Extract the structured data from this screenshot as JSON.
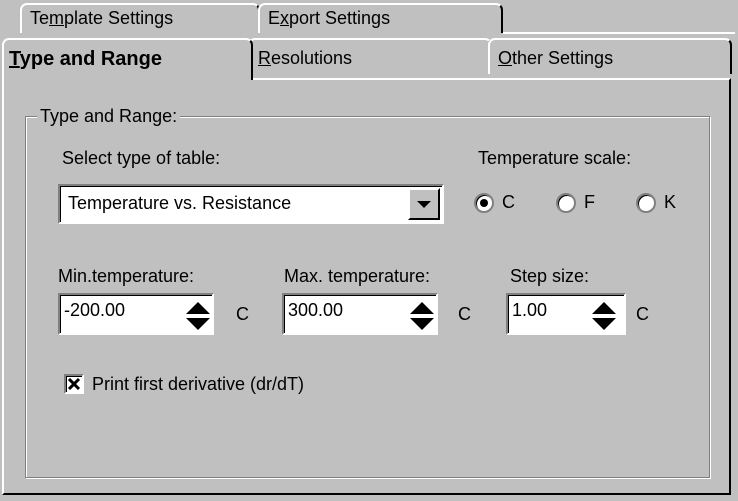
{
  "tabs": {
    "template": {
      "pre": "Te",
      "key": "m",
      "post": "plate Settings"
    },
    "export": {
      "pre": "E",
      "key": "x",
      "post": "port Settings"
    },
    "type_range": {
      "pre": "",
      "key": "T",
      "post": "ype and Range"
    },
    "resolutions": {
      "pre": "",
      "key": "R",
      "post": "esolutions"
    },
    "other": {
      "pre": "",
      "key": "O",
      "post": "ther Settings"
    }
  },
  "group": {
    "title": "Type and Range:"
  },
  "table_type": {
    "label": "Select type of table:",
    "value": "Temperature vs. Resistance"
  },
  "scale": {
    "label": "Temperature scale:",
    "options": [
      "C",
      "F",
      "K"
    ],
    "selected": "C"
  },
  "min_temp": {
    "label": "Min.temperature:",
    "value": "-200.00",
    "unit": "C"
  },
  "max_temp": {
    "label": "Max. temperature:",
    "value": "300.00",
    "unit": "C"
  },
  "step": {
    "label": "Step size:",
    "value": "1.00",
    "unit": "C"
  },
  "derivative": {
    "label": "Print first derivative (dr/dT)",
    "checked": true
  }
}
